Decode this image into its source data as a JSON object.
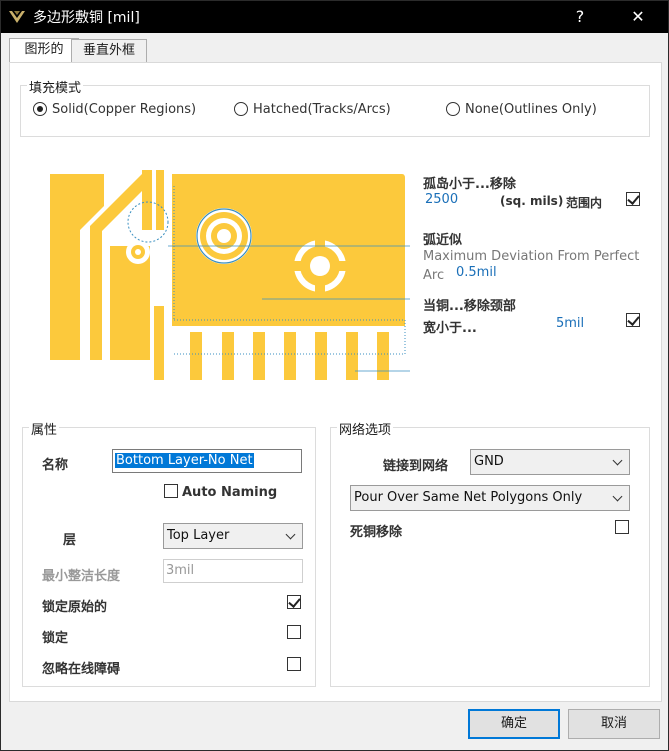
{
  "window": {
    "title": "多边形敷铜 [mil]",
    "help_label": "?",
    "close_label": "✕"
  },
  "tabs": [
    {
      "label": "图形的",
      "active": true
    },
    {
      "label": "垂直外框",
      "active": false
    }
  ],
  "fill_mode": {
    "title": "填充模式",
    "options": [
      {
        "label": "Solid(Copper Regions)",
        "selected": true
      },
      {
        "label": "Hatched(Tracks/Arcs)",
        "selected": false
      },
      {
        "label": "None(Outlines Only)",
        "selected": false
      }
    ]
  },
  "island": {
    "label": "孤岛小于...移除",
    "value": "2500",
    "unit": "(sq. mils)",
    "range_label": "范围内",
    "checked": true
  },
  "arc": {
    "label": "弧近似",
    "desc": "Maximum Deviation From Perfect",
    "desc2": "Arc",
    "value": "0.5mil"
  },
  "neck": {
    "label": "当铜...移除颈部",
    "label2": "宽小于...",
    "value": "5mil",
    "checked": true
  },
  "properties": {
    "title": "属性",
    "name_label": "名称",
    "name_value": "Bottom Layer-No Net",
    "auto_naming_label": "Auto Naming",
    "auto_naming_checked": false,
    "layer_label": "层",
    "layer_value": "Top Layer",
    "min_length_label": "最小整洁长度",
    "min_length_value": "3mil",
    "lock_primitives_label": "锁定原始的",
    "lock_primitives_checked": true,
    "locked_label": "锁定",
    "locked_checked": false,
    "ignore_obstacles_label": "忽略在线障碍",
    "ignore_obstacles_checked": false
  },
  "net_options": {
    "title": "网络选项",
    "connect_label": "链接到网络",
    "net_value": "GND",
    "pour_over_value": "Pour Over Same Net Polygons Only",
    "remove_dead_label": "死铜移除",
    "remove_dead_checked": false
  },
  "buttons": {
    "ok": "确定",
    "cancel": "取消"
  },
  "colors": {
    "copper": "#fcc93c",
    "accent": "#0078d7",
    "link_blue": "#1a6fb8"
  }
}
